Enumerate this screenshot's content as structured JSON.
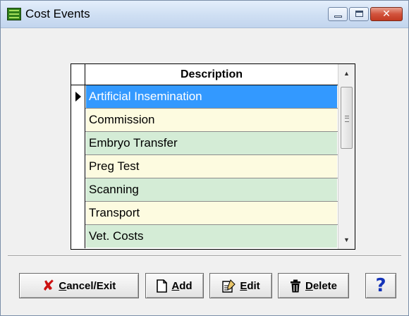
{
  "window": {
    "title": "Cost Events",
    "close_glyph": "✕"
  },
  "grid": {
    "header": "Description",
    "rows": [
      {
        "description": "Artificial Insemination",
        "selected": true
      },
      {
        "description": "Commission",
        "selected": false
      },
      {
        "description": "Embryo Transfer",
        "selected": false
      },
      {
        "description": "Preg Test",
        "selected": false
      },
      {
        "description": "Scanning",
        "selected": false
      },
      {
        "description": "Transport",
        "selected": false
      },
      {
        "description": "Vet. Costs",
        "selected": false
      }
    ],
    "scroll_up_glyph": "▲",
    "scroll_down_glyph": "▼"
  },
  "toolbar": {
    "cancel": {
      "mnemonic": "C",
      "rest": "ancel/Exit",
      "icon": "x-icon"
    },
    "add": {
      "mnemonic": "A",
      "rest": "dd",
      "icon": "new-document-icon"
    },
    "edit": {
      "mnemonic": "E",
      "rest": "dit",
      "icon": "edit-document-icon"
    },
    "delete": {
      "mnemonic": "D",
      "rest": "elete",
      "icon": "trash-icon"
    },
    "help": {
      "glyph": "?",
      "icon": "help-icon"
    }
  },
  "colors": {
    "selected_row": "#3399ff",
    "cream_row": "#fdfbe0",
    "green_row": "#d4ecd6",
    "cancel_icon": "#cc1010",
    "help_icon": "#1433b8"
  }
}
